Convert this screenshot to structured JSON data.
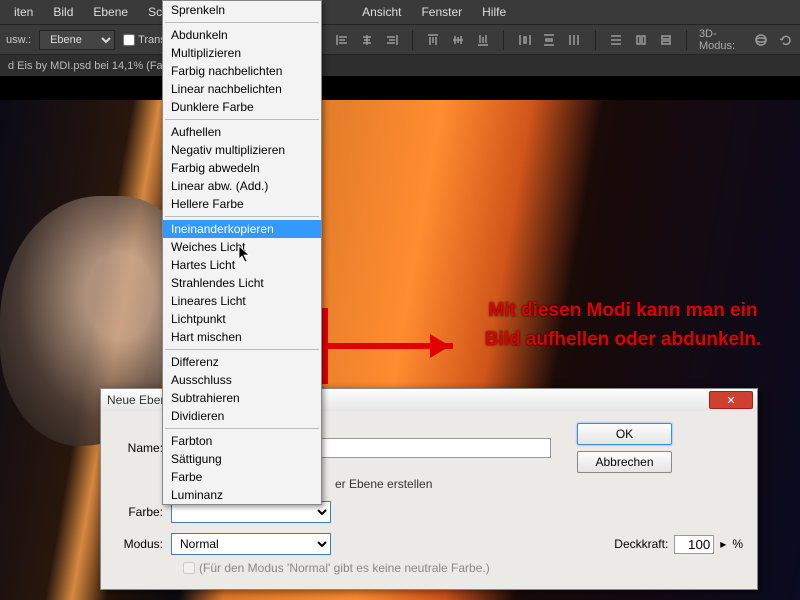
{
  "menubar": {
    "items": [
      "iten",
      "Bild",
      "Ebene",
      "Schrift",
      "",
      "Ansicht",
      "Fenster",
      "Hilfe"
    ]
  },
  "toolbar": {
    "usw_label": "usw.:",
    "layer_select": "Ebene",
    "trans_label": "Trans",
    "mode3d": "3D-Modus:"
  },
  "doctab": "d Eis by MDI.psd bei 14,1% (Fa",
  "dropdown": {
    "groups": [
      [
        "Sprenkeln"
      ],
      [
        "Abdunkeln",
        "Multiplizieren",
        "Farbig nachbelichten",
        "Linear nachbelichten",
        "Dunklere Farbe"
      ],
      [
        "Aufhellen",
        "Negativ multiplizieren",
        "Farbig abwedeln",
        "Linear abw. (Add.)",
        "Hellere Farbe"
      ],
      [
        "Ineinanderkopieren",
        "Weiches Licht",
        "Hartes Licht",
        "Strahlendes Licht",
        "Lineares Licht",
        "Lichtpunkt",
        "Hart mischen"
      ],
      [
        "Differenz",
        "Ausschluss",
        "Subtrahieren",
        "Dividieren"
      ],
      [
        "Farbton",
        "Sättigung",
        "Farbe",
        "Luminanz"
      ]
    ],
    "highlighted": "Ineinanderkopieren"
  },
  "annotation": "Mit diesen Modi kann man ein Bild aufhellen oder abdunkeln.",
  "dialog": {
    "title": "Neue Ebene",
    "name_label": "Name:",
    "name_value": "",
    "sub_check": "er Ebene erstellen",
    "color_label": "Farbe:",
    "mode_label": "Modus:",
    "mode_value": "Normal",
    "opacity_label": "Deckkraft:",
    "opacity_value": "100",
    "opacity_unit": "%",
    "note": "(Für den Modus 'Normal' gibt es keine neutrale Farbe.)",
    "ok": "OK",
    "cancel": "Abbrechen"
  }
}
